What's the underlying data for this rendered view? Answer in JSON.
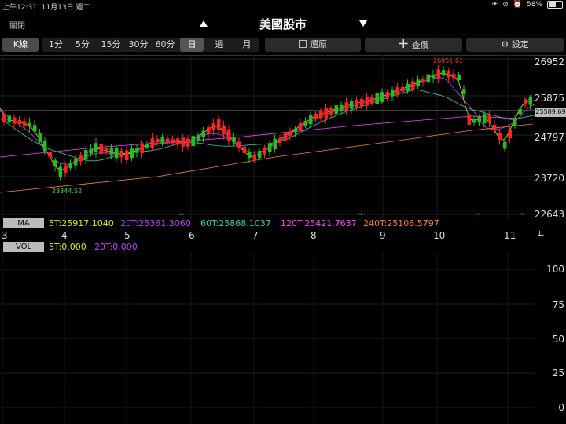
{
  "status_bar": {
    "time": "上午12:31",
    "date": "11月13日 週二",
    "battery": "58%",
    "battery_level": 0.58
  },
  "titlebar": {
    "close": "關閉",
    "title": "美國股市"
  },
  "toolbar": {
    "chart_type": "K線",
    "periods": [
      "1分",
      "5分",
      "15分",
      "30分",
      "60分",
      "日",
      "週",
      "月"
    ],
    "selected_period": "日",
    "restore": "還原",
    "query": "查價",
    "settings": "設定"
  },
  "main_chart": {
    "y_labels": [
      "26952",
      "25875",
      "24797",
      "23720",
      "22643"
    ],
    "last_price": "25589.69",
    "high_label": "26951.81",
    "low_label": "23344.52"
  },
  "ma_legend": {
    "badge": "MA",
    "items": [
      {
        "text": "5T:25917.1040",
        "color": "#e8e800"
      },
      {
        "text": "20T:25361.3060",
        "color": "#c040ff"
      },
      {
        "text": "60T:25868.1037",
        "color": "#30d0b0"
      },
      {
        "text": "120T:25421.7637",
        "color": "#ff40ff"
      },
      {
        "text": "240T:25106.5797",
        "color": "#ff8030"
      }
    ]
  },
  "x_dates": [
    "3",
    "4",
    "5",
    "6",
    "7",
    "8",
    "9",
    "10",
    "11"
  ],
  "vol_legend": {
    "badge": "VOL",
    "items": [
      {
        "text": "5T:0.000",
        "color": "#e8e800"
      },
      {
        "text": "20T:0.000",
        "color": "#c040ff"
      }
    ]
  },
  "vol_y_labels": [
    "100",
    "75",
    "50",
    "25",
    "0"
  ],
  "colors": {
    "up": "#ff2020",
    "down": "#20c020",
    "background": "#000000"
  }
}
